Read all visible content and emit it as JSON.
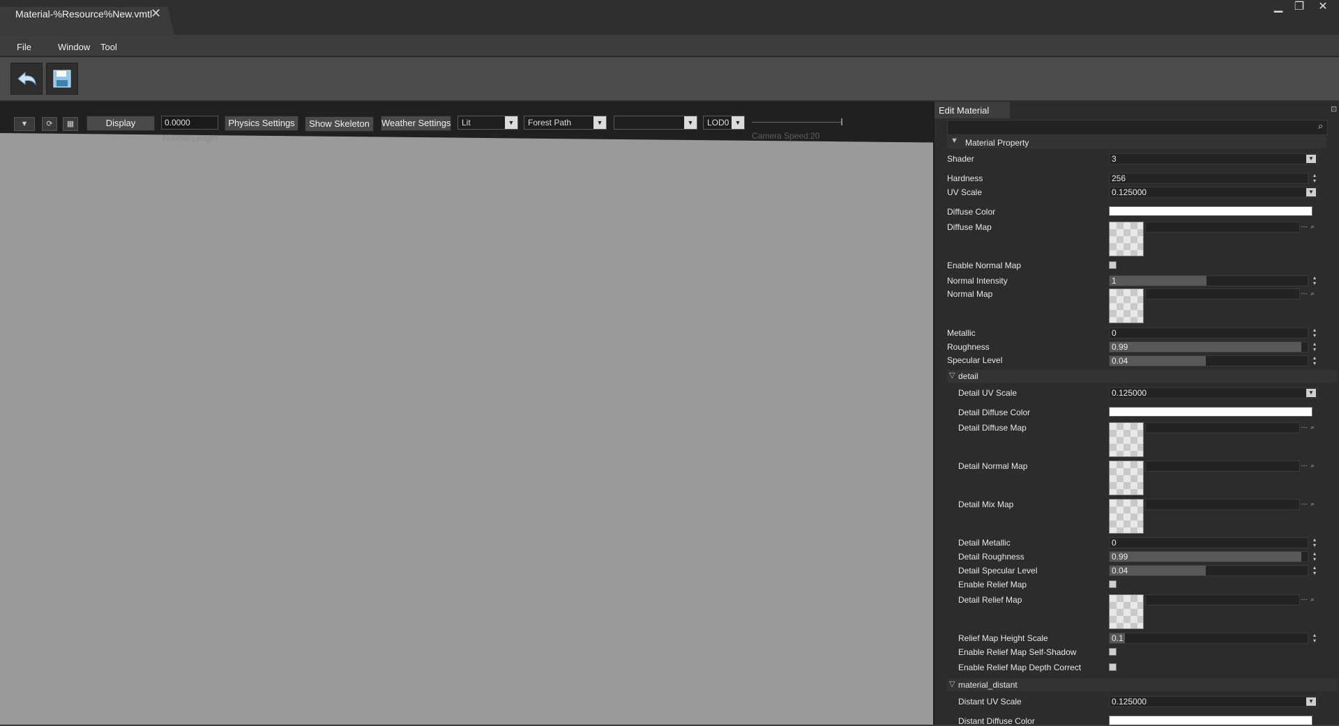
{
  "window": {
    "tab_title": "Material-%Resource%New.vmtl",
    "close_glyph": "✕",
    "minimize_glyph": "▁",
    "restore_glyph": "❐",
    "close_window_glyph": "✕"
  },
  "menu": {
    "file": "File",
    "window": "Window",
    "tool": "Tool"
  },
  "toolbar": {
    "undo_icon": "undo-icon",
    "save_icon": "save-icon"
  },
  "viewport": {
    "display_label": "Display",
    "normal_length_value": "0.0000",
    "normal_length_label": "Normal Length",
    "physics_settings": "Physics Settings",
    "show_skeleton": "Show Skeleton",
    "weather_settings": "Weather Settings",
    "lighting_mode": "Lit",
    "scene": "Forest Path",
    "empty_combo": "",
    "lod": "LOD0",
    "camera_speed": "Camera Speed:20"
  },
  "panel": {
    "tab_label": "Edit Material",
    "section_material_property": "Material Property",
    "shader_label": "Shader",
    "shader_value": "3",
    "hardness_label": "Hardness",
    "hardness_value": "256",
    "uv_scale_label": "UV Scale",
    "uv_scale_value": "0.125000",
    "diffuse_color_label": "Diffuse Color",
    "diffuse_map_label": "Diffuse Map",
    "enable_normal_map_label": "Enable Normal Map",
    "normal_intensity_label": "Normal Intensity",
    "normal_intensity_value": "1",
    "normal_map_label": "Normal Map",
    "metallic_label": "Metallic",
    "metallic_value": "0",
    "roughness_label": "Roughness",
    "roughness_value": "0.99",
    "specular_level_label": "Specular Level",
    "specular_level_value": "0.04",
    "section_detail": "detail",
    "detail_uv_scale_label": "Detail UV Scale",
    "detail_uv_scale_value": "0.125000",
    "detail_diffuse_color_label": "Detail Diffuse Color",
    "detail_diffuse_map_label": "Detail Diffuse Map",
    "detail_normal_map_label": "Detail Normal Map",
    "detail_mix_map_label": "Detail Mix Map",
    "detail_metallic_label": "Detail Metallic",
    "detail_metallic_value": "0",
    "detail_roughness_label": "Detail Roughness",
    "detail_roughness_value": "0.99",
    "detail_specular_level_label": "Detail Specular Level",
    "detail_specular_level_value": "0.04",
    "enable_relief_map_label": "Enable Relief Map",
    "detail_relief_map_label": "Detail Relief Map",
    "relief_height_scale_label": "Relief Map Height Scale",
    "relief_height_scale_value": "0.1",
    "relief_self_shadow_label": "Enable Relief Map Self-Shadow",
    "relief_depth_correct_label": "Enable Relief Map Depth Correct",
    "section_material_distant": "material_distant",
    "distant_uv_scale_label": "Distant UV Scale",
    "distant_uv_scale_value": "0.125000",
    "distant_diffuse_color_label": "Distant Diffuse Color"
  },
  "colors": {
    "accent": "#4a90d9",
    "viewport_bg": "#9a9a9a",
    "panel_bg": "#2c2c2c"
  }
}
